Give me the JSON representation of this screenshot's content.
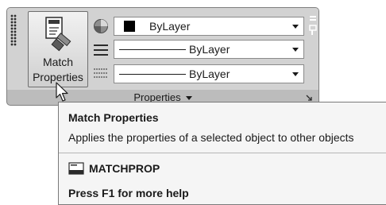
{
  "panel": {
    "title": "Properties",
    "match_button_line1": "Match",
    "match_button_line2": "Properties",
    "color_value": "ByLayer",
    "linetype_value": "ByLayer",
    "lineweight_value": "ByLayer",
    "color_swatch": "#000000"
  },
  "tooltip": {
    "title": "Match Properties",
    "description": "Applies the properties of a selected object to other objects",
    "command": "MATCHPROP",
    "help": "Press F1 for more help"
  },
  "icons": {
    "match_properties": "match-properties-icon",
    "color": "color-wheel-icon",
    "linetype": "linetype-icon",
    "lineweight": "lineweight-icon",
    "command": "command-line-icon",
    "cursor": "mouse-pointer-icon"
  }
}
